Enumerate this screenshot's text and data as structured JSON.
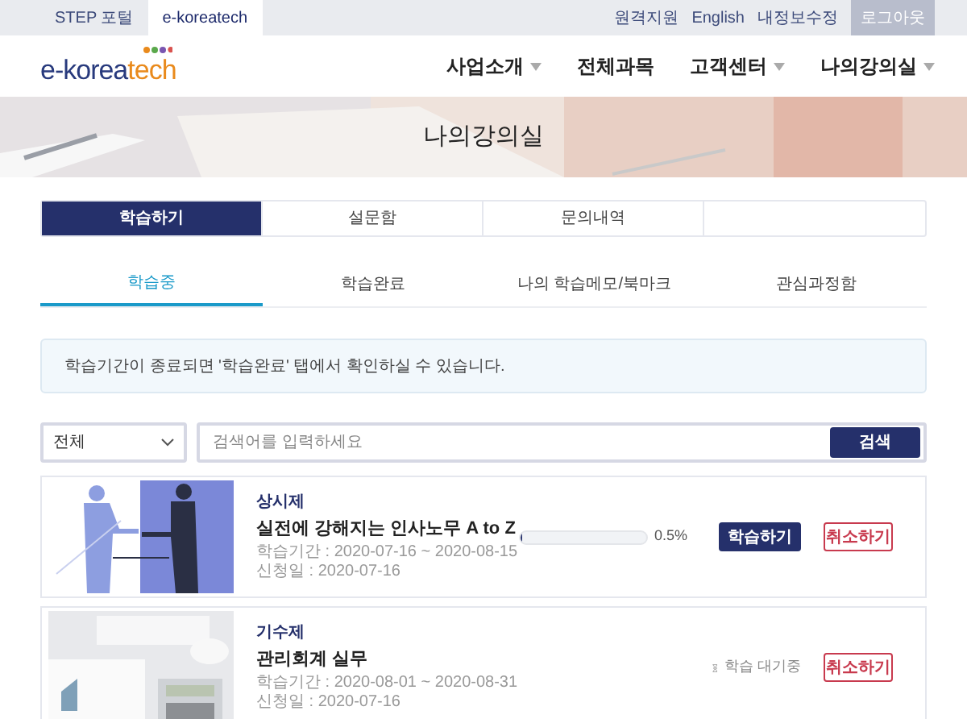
{
  "top_tabs": [
    {
      "label": "STEP 포털",
      "selected": false
    },
    {
      "label": "e-koreatech",
      "selected": true
    }
  ],
  "top_links": [
    "원격지원",
    "English",
    "내정보수정"
  ],
  "logout_button": "로그아웃",
  "logo": {
    "part1": "e-korea",
    "part2": "tech"
  },
  "nav": [
    {
      "label": "사업소개",
      "has_menu": true
    },
    {
      "label": "전체과목",
      "has_menu": false
    },
    {
      "label": "고객센터",
      "has_menu": true
    },
    {
      "label": "나의강의실",
      "has_menu": true
    }
  ],
  "banner": {
    "title": "나의강의실",
    "kind": "picture"
  },
  "main_tabs": [
    {
      "label": "학습하기",
      "selected": true
    },
    {
      "label": "설문함",
      "selected": false
    },
    {
      "label": "문의내역",
      "selected": false
    }
  ],
  "sub_tabs": [
    {
      "label": "학습중",
      "selected": true
    },
    {
      "label": "학습완료",
      "selected": false
    },
    {
      "label": "나의 학습메모/북마크",
      "selected": false
    },
    {
      "label": "관심과정함",
      "selected": false
    }
  ],
  "notice": "학습기간이 종료되면 '학습완료' 탭에서 확인하실 수 있습니다.",
  "filter": {
    "value": "전체"
  },
  "search": {
    "placeholder": "검색어를 입력하세요",
    "button": "검색"
  },
  "courses": [
    {
      "kind": "progress",
      "type": "상시제",
      "title": "실전에 강해지는 인사노무 A to Z",
      "period": "학습기간 : 2020-07-16 ~ 2020-08-15",
      "applied": "신청일 : 2020-07-16",
      "level": 0.005,
      "reading": "0.5%",
      "study_button": "학습하기",
      "cancel_button": "취소하기"
    },
    {
      "kind": "waiting",
      "type": "기수제",
      "title": "관리회계 실무",
      "period": "학습기간 : 2020-08-01 ~ 2020-08-31",
      "applied": "신청일 : 2020-07-16",
      "status": "학습 대기중",
      "cancel_button": "취소하기"
    }
  ]
}
